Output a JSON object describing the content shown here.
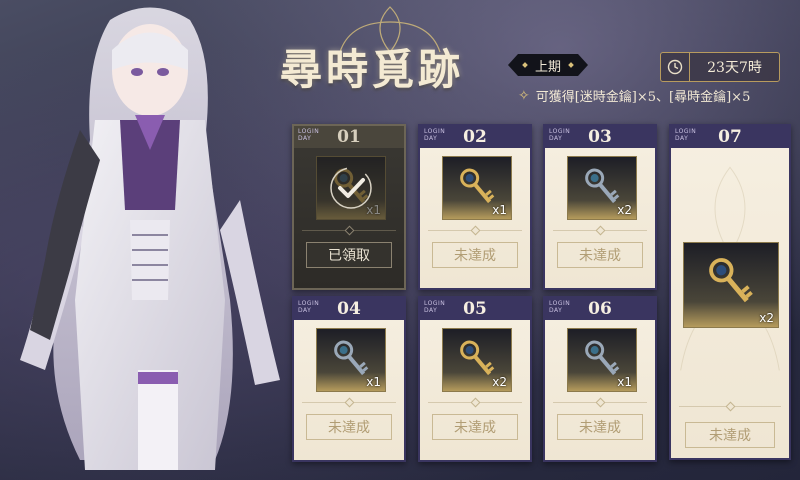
{
  "event": {
    "title": "尋時覓跡",
    "period": "上期",
    "timer_icon": "clock-icon",
    "time_left": "23天7時",
    "reward_text": "可獲得[迷時金鑰]×5、[尋時金鑰]×5"
  },
  "login_label_line1": "LOGIN",
  "login_label_line2": "DAY",
  "days": [
    {
      "day": "01",
      "item": "key-icon",
      "qty": "x1",
      "status": "已領取",
      "claimed": true
    },
    {
      "day": "02",
      "item": "key-icon",
      "qty": "x1",
      "status": "未達成",
      "claimed": false
    },
    {
      "day": "03",
      "item": "key-icon",
      "qty": "x2",
      "status": "未達成",
      "claimed": false
    },
    {
      "day": "04",
      "item": "key-icon",
      "qty": "x1",
      "status": "未達成",
      "claimed": false
    },
    {
      "day": "05",
      "item": "key-icon",
      "qty": "x2",
      "status": "未達成",
      "claimed": false
    },
    {
      "day": "06",
      "item": "key-icon",
      "qty": "x1",
      "status": "未達成",
      "claimed": false
    },
    {
      "day": "07",
      "item": "key-icon",
      "qty": "x2",
      "status": "未達成",
      "claimed": false
    }
  ],
  "colors": {
    "card_header": "#3a3560",
    "card_bg": "#f6efe1",
    "accent_gold": "#d9c07a"
  }
}
